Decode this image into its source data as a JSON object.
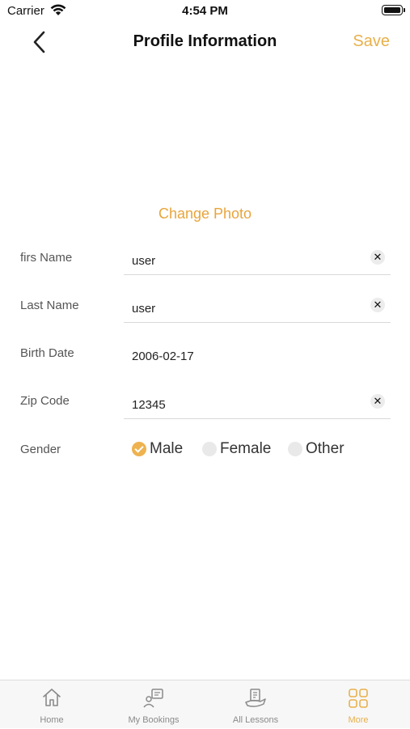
{
  "status_bar": {
    "carrier": "Carrier",
    "time": "4:54 PM"
  },
  "nav": {
    "title": "Profile Information",
    "save_label": "Save"
  },
  "change_photo_label": "Change Photo",
  "form": {
    "first_name": {
      "label": "firs Name",
      "value": "user"
    },
    "last_name": {
      "label": "Last Name",
      "value": "user"
    },
    "birth_date": {
      "label": "Birth Date",
      "value": "2006-02-17"
    },
    "zip_code": {
      "label": "Zip Code",
      "value": "12345"
    },
    "gender": {
      "label": "Gender",
      "options": [
        "Male",
        "Female",
        "Other"
      ],
      "selected": "Male"
    }
  },
  "tabs": [
    {
      "label": "Home",
      "icon": "home-icon",
      "active": false
    },
    {
      "label": "My Bookings",
      "icon": "bookings-icon",
      "active": false
    },
    {
      "label": "All Lessons",
      "icon": "lessons-icon",
      "active": false
    },
    {
      "label": "More",
      "icon": "grid-icon",
      "active": true
    }
  ],
  "colors": {
    "accent": "#e8b04a",
    "radio_selected": "#eeb24f",
    "radio_unselected": "#e9e9e9",
    "tab_inactive": "#8a8a8a"
  }
}
